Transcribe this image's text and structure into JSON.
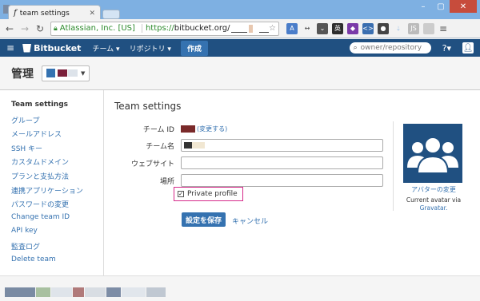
{
  "browser": {
    "tab_title": "team settings",
    "tab_favicon": "f",
    "ev_label": "Atlassian, Inc. [US]",
    "url_scheme": "https://",
    "url_host": "bitbucket.org/"
  },
  "header": {
    "logo": "Bitbucket",
    "nav_team": "チーム ▾",
    "nav_repo": "リポジトリ ▾",
    "create": "作成",
    "search_placeholder": "owner/repository",
    "help": "?▾"
  },
  "page": {
    "title": "管理"
  },
  "sidebar": {
    "items": [
      {
        "label": "Team settings"
      },
      {
        "label": "グループ"
      },
      {
        "label": "メールアドレス"
      },
      {
        "label": "SSH キー"
      },
      {
        "label": "カスタムドメイン"
      },
      {
        "label": "プランと支払方法"
      },
      {
        "label": "連携アプリケーション"
      },
      {
        "label": "パスワードの変更"
      },
      {
        "label": "Change team ID"
      },
      {
        "label": "API key"
      },
      {
        "label": "監査ログ"
      },
      {
        "label": "Delete team"
      }
    ]
  },
  "form": {
    "heading": "Team settings",
    "team_id_label": "チーム ID",
    "team_id_change": "(変更する)",
    "team_name_label": "チーム名",
    "website_label": "ウェブサイト",
    "location_label": "場所",
    "private_label": "Private profile",
    "private_checked": true,
    "save": "設定を保存",
    "cancel": "キャンセル"
  },
  "avatar": {
    "change": "アバターの変更",
    "note": "Current avatar via",
    "source": "Gravatar."
  },
  "colors": {
    "header_bg": "#205081",
    "link": "#3572b0",
    "highlight": "#d62a8a"
  }
}
